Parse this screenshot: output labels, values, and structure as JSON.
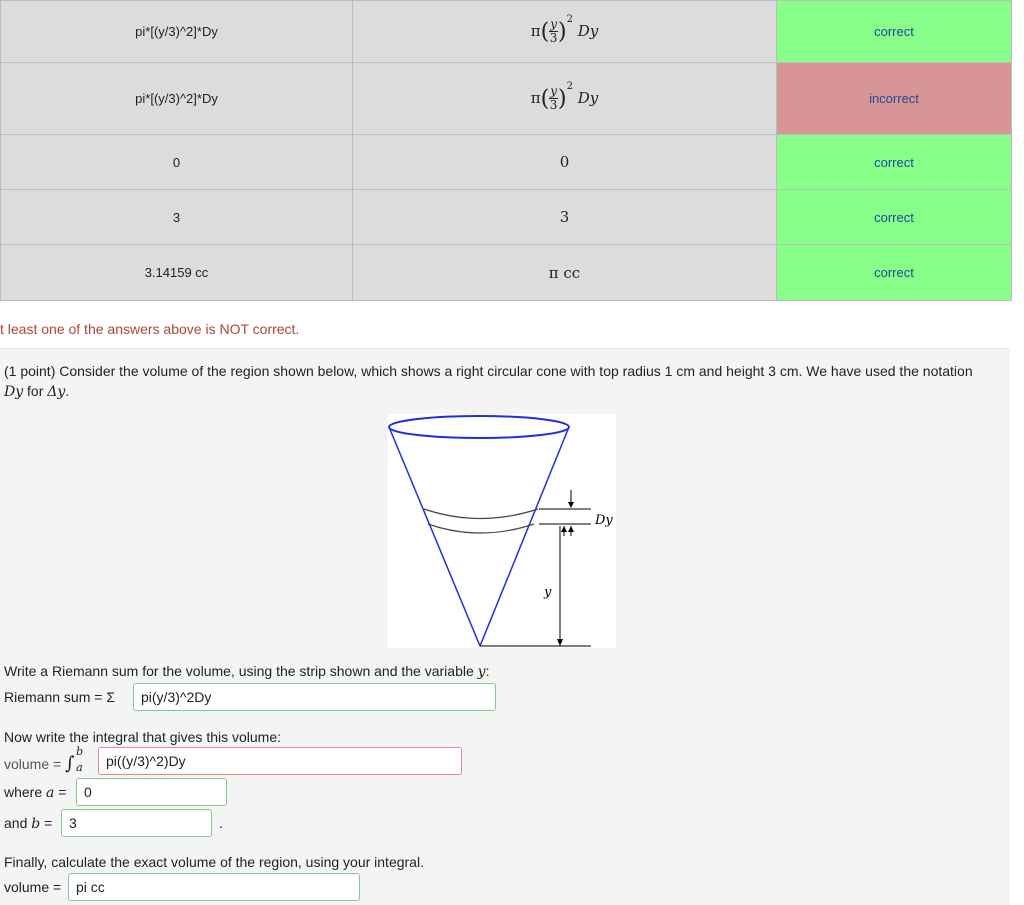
{
  "results": {
    "rows": [
      {
        "entered": "pi*[(y/3)^2]*Dy",
        "preview": {
          "type": "riemann",
          "pi": "π",
          "num": "y",
          "den": "3",
          "exp": "2",
          "tail": "Dy"
        },
        "status": "correct",
        "state": "ok"
      },
      {
        "entered": "pi*[(y/3)^2]*Dy",
        "preview": {
          "type": "riemann",
          "pi": "π",
          "num": "y",
          "den": "3",
          "exp": "2",
          "tail": "Dy"
        },
        "status": "incorrect",
        "state": "bad"
      },
      {
        "entered": "0",
        "preview": {
          "type": "text",
          "text": "0"
        },
        "status": "correct",
        "state": "ok"
      },
      {
        "entered": "3",
        "preview": {
          "type": "text",
          "text": "3"
        },
        "status": "correct",
        "state": "ok"
      },
      {
        "entered": "3.14159 cc",
        "preview": {
          "type": "text",
          "text": "π cc"
        },
        "status": "correct",
        "state": "ok"
      }
    ]
  },
  "warning": "t least one of the answers above is NOT correct.",
  "problem": {
    "intro": "(1 point) Consider the volume of the region shown below, which shows a right circular cone with top radius 1 cm and height 3 cm. We have used the notation",
    "notation_dy": "Dy",
    "notation_for": " for ",
    "notation_delta": "Δy",
    "notation_end": ".",
    "figure": {
      "label_dy": "Dy",
      "label_y": "y"
    },
    "riemann_prompt": "Write a Riemann sum for the volume, using the strip shown and the variable",
    "riemann_var": "y",
    "riemann_prompt_end": ":",
    "riemann_label": "Riemann sum = Σ",
    "riemann_value": "pi(y/3)^2Dy",
    "integral_prompt": "Now write the integral that gives this volume:",
    "volume_label": "volume = ",
    "integral_symbol": "∫",
    "integral_lower": "a",
    "integral_upper": "b",
    "integral_value": "pi((y/3)^2)Dy",
    "where_label": "where",
    "a_var": "a",
    "a_eq": "=",
    "a_value": "0",
    "and_label": "and",
    "b_var": "b",
    "b_eq": "=",
    "b_value": "3",
    "b_period": ".",
    "final_prompt": "Finally, calculate the exact volume of the region, using your integral.",
    "final_label": "volume =",
    "final_value": "pi cc"
  },
  "colors": {
    "correct_bg": "#88ff88",
    "incorrect_bg": "#d89595",
    "status_text": "#1c4a9c",
    "warning": "#b0453b",
    "cone": "#1f2fe0"
  }
}
